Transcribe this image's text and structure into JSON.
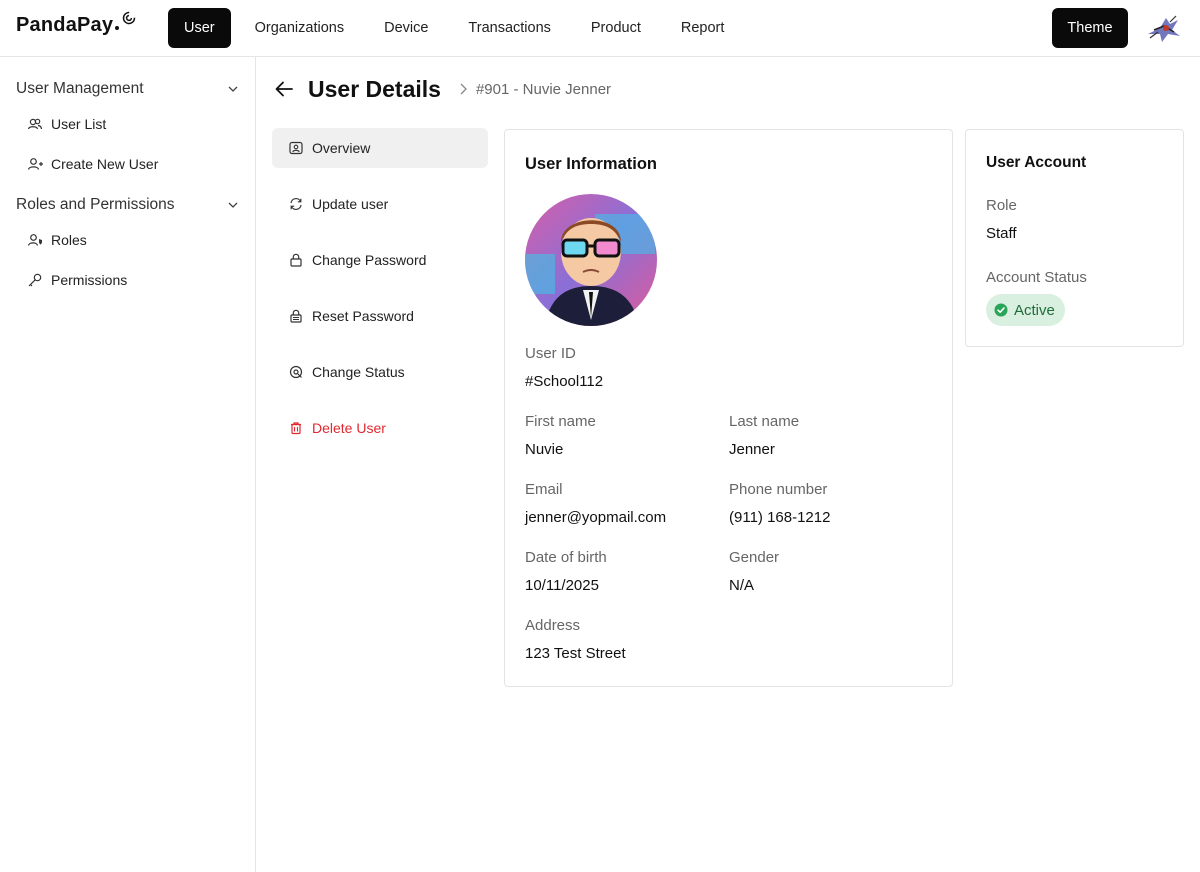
{
  "brand": {
    "name": "PandaPay"
  },
  "nav": {
    "items": [
      {
        "label": "User",
        "active": true
      },
      {
        "label": "Organizations",
        "active": false
      },
      {
        "label": "Device",
        "active": false
      },
      {
        "label": "Transactions",
        "active": false
      },
      {
        "label": "Product",
        "active": false
      },
      {
        "label": "Report",
        "active": false
      }
    ],
    "theme_label": "Theme"
  },
  "sidebar": {
    "groups": [
      {
        "title": "User Management",
        "items": [
          {
            "label": "User List",
            "icon": "users-icon"
          },
          {
            "label": "Create New User",
            "icon": "user-plus-icon"
          }
        ]
      },
      {
        "title": "Roles and Permissions",
        "items": [
          {
            "label": "Roles",
            "icon": "user-shield-icon"
          },
          {
            "label": "Permissions",
            "icon": "key-icon"
          }
        ]
      }
    ]
  },
  "page": {
    "title": "User Details",
    "breadcrumb": "#901 - Nuvie Jenner"
  },
  "actions": [
    {
      "label": "Overview",
      "icon": "user-card-icon",
      "active": true
    },
    {
      "label": "Update user",
      "icon": "refresh-icon",
      "active": false
    },
    {
      "label": "Change Password",
      "icon": "lock-icon",
      "active": false
    },
    {
      "label": "Reset Password",
      "icon": "lock-reset-icon",
      "active": false
    },
    {
      "label": "Change Status",
      "icon": "status-icon",
      "active": false
    },
    {
      "label": "Delete User",
      "icon": "trash-icon",
      "active": false,
      "danger": true
    }
  ],
  "user_info": {
    "title": "User Information",
    "user_id_label": "User ID",
    "user_id": "#School112",
    "first_name_label": "First name",
    "first_name": "Nuvie",
    "last_name_label": "Last name",
    "last_name": "Jenner",
    "email_label": "Email",
    "email": "jenner@yopmail.com",
    "phone_label": "Phone number",
    "phone": "(911) 168-1212",
    "dob_label": "Date of birth",
    "dob": "10/11/2025",
    "gender_label": "Gender",
    "gender": "N/A",
    "address_label": "Address",
    "address": "123 Test Street"
  },
  "account": {
    "title": "User Account",
    "role_label": "Role",
    "role": "Staff",
    "status_label": "Account Status",
    "status": "Active"
  },
  "colors": {
    "primary": "#0a0a0a",
    "danger": "#e0282e",
    "success_bg": "#d9efe0",
    "success_text": "#1f6d3a",
    "success_icon": "#2aa457"
  }
}
